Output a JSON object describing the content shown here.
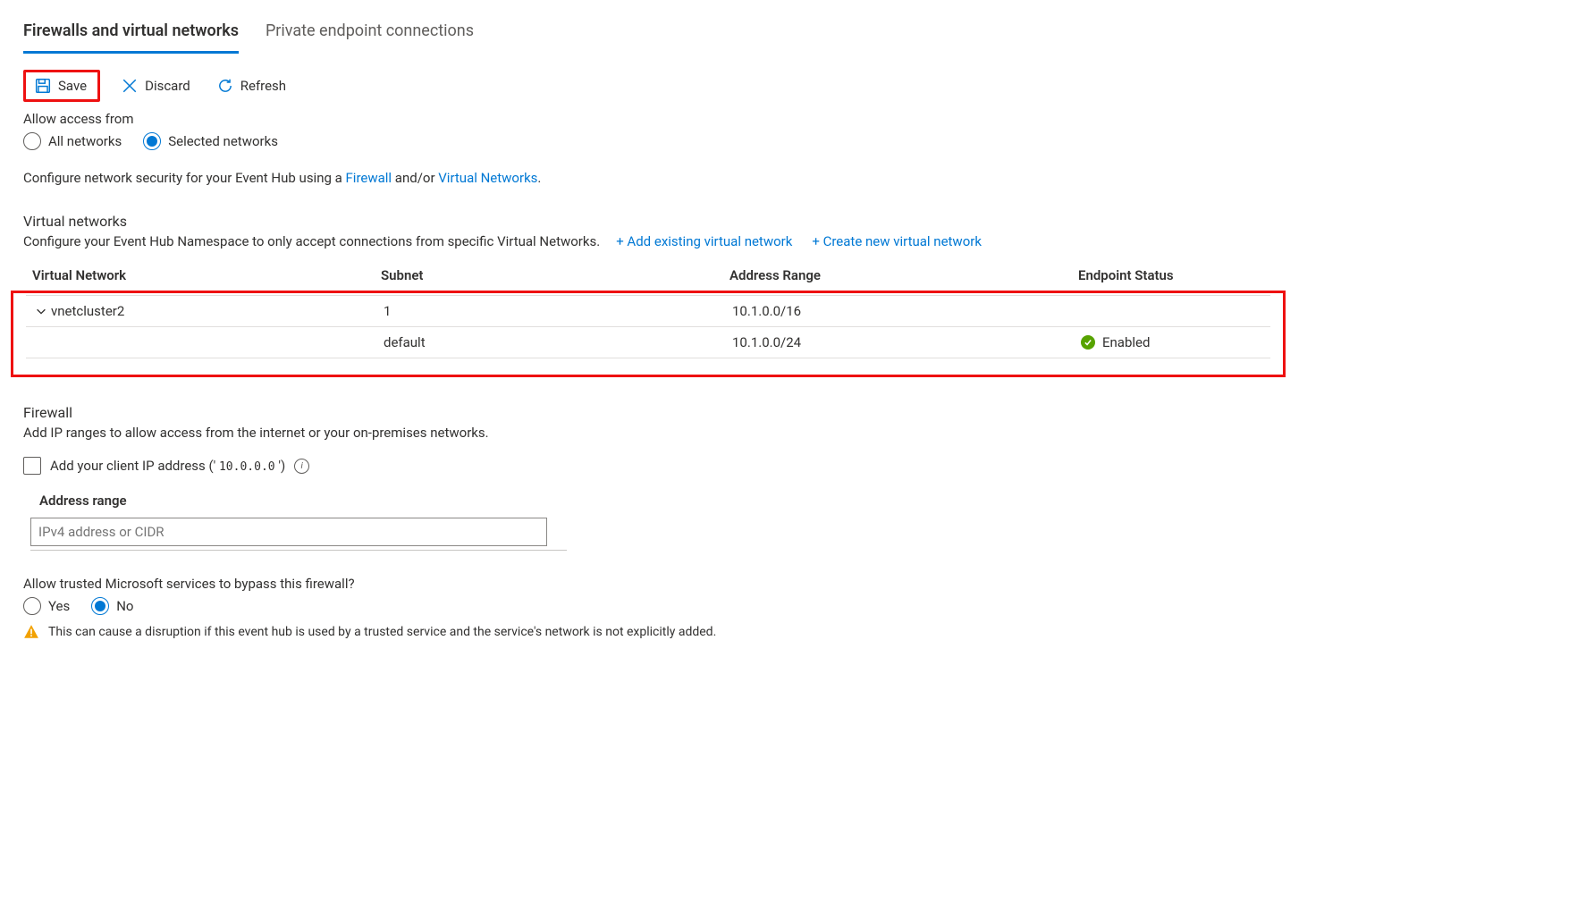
{
  "tabs": {
    "firewalls": "Firewalls and virtual networks",
    "private_endpoints": "Private endpoint connections"
  },
  "toolbar": {
    "save": "Save",
    "discard": "Discard",
    "refresh": "Refresh"
  },
  "access": {
    "label": "Allow access from",
    "option_all": "All networks",
    "option_selected": "Selected networks"
  },
  "config_desc": {
    "prefix": "Configure network security for your Event Hub using a ",
    "firewall_link": "Firewall",
    "mid": " and/or ",
    "vnet_link": "Virtual Networks",
    "suffix": "."
  },
  "vnets": {
    "heading": "Virtual networks",
    "sub": "Configure your Event Hub Namespace to only accept connections from specific Virtual Networks.",
    "add_existing": "+ Add existing virtual network",
    "create_new": "+ Create new virtual network",
    "columns": {
      "vn": "Virtual Network",
      "subnet": "Subnet",
      "range": "Address Range",
      "endpoint": "Endpoint Status"
    },
    "rows": [
      {
        "name": "vnetcluster2",
        "subnet": "1",
        "range": "10.1.0.0/16",
        "endpoint": ""
      },
      {
        "name": "",
        "subnet": "default",
        "range": "10.1.0.0/24",
        "endpoint": "Enabled"
      }
    ]
  },
  "firewall": {
    "heading": "Firewall",
    "desc": "Add IP ranges to allow access from the internet or your on-premises networks.",
    "client_ip_label_prefix": "Add your client IP address (' ",
    "client_ip_value": "10.0.0.0",
    "client_ip_label_suffix": "  ')",
    "addr_label": "Address range",
    "addr_placeholder": "IPv4 address or CIDR"
  },
  "bypass": {
    "label": "Allow trusted Microsoft services to bypass this firewall?",
    "yes": "Yes",
    "no": "No",
    "warning": "This can cause a disruption if this event hub is used by a trusted service and the service's network is not explicitly added."
  }
}
